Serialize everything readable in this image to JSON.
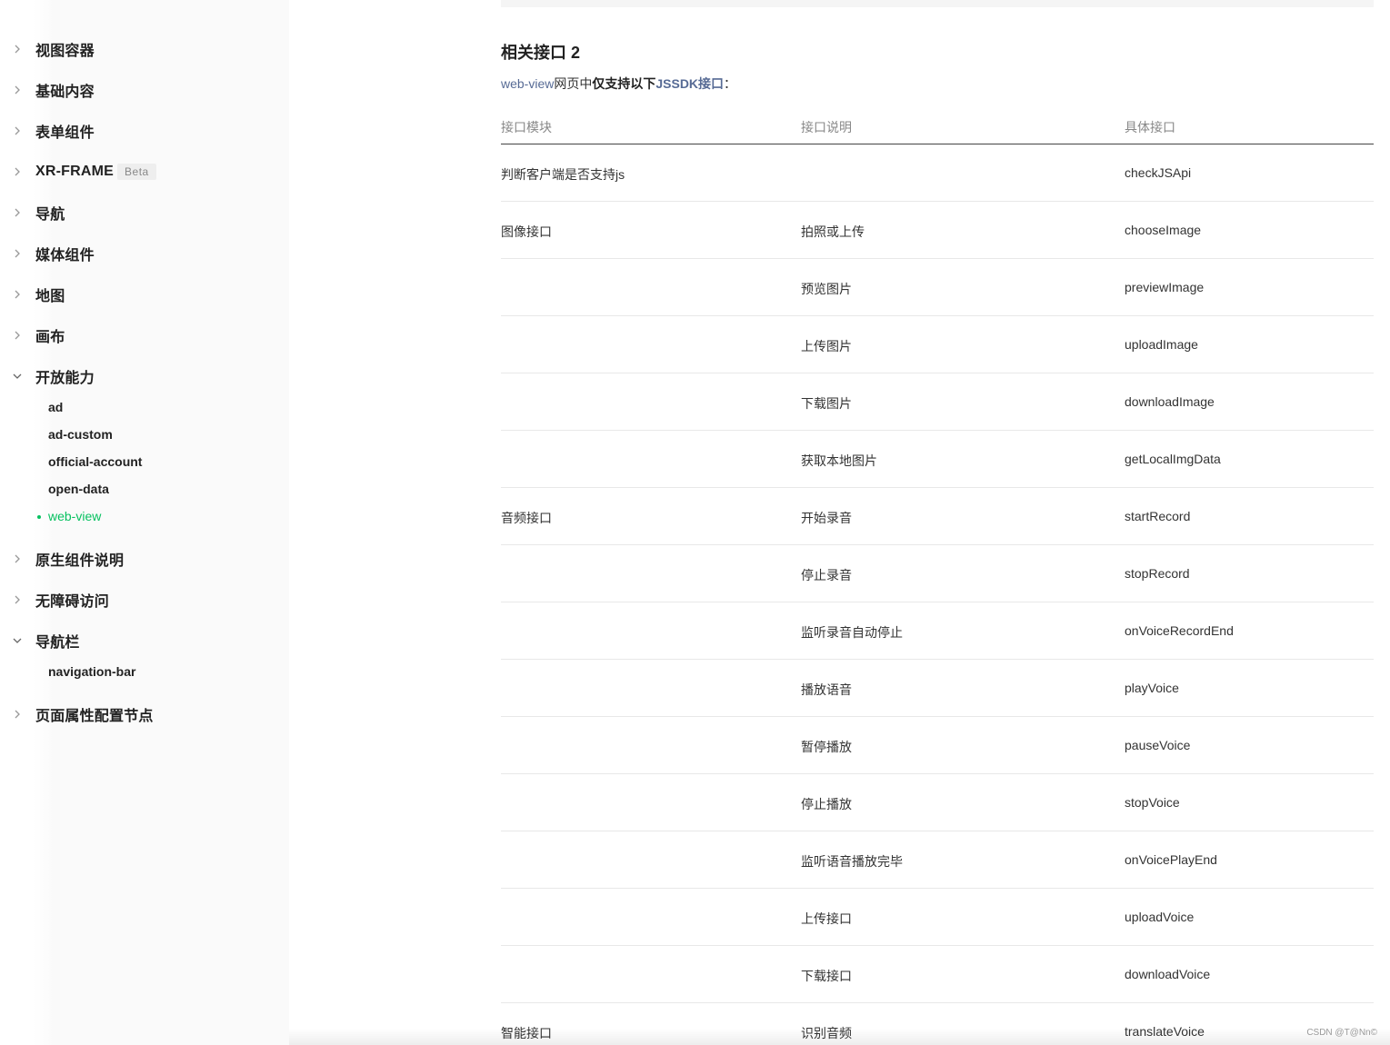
{
  "sidebar": {
    "items": [
      {
        "label": "视图容器",
        "expanded": false
      },
      {
        "label": "基础内容",
        "expanded": false
      },
      {
        "label": "表单组件",
        "expanded": false
      },
      {
        "label": "XR-FRAME",
        "badge": "Beta",
        "expanded": false
      },
      {
        "label": "导航",
        "expanded": false
      },
      {
        "label": "媒体组件",
        "expanded": false
      },
      {
        "label": "地图",
        "expanded": false
      },
      {
        "label": "画布",
        "expanded": false
      },
      {
        "label": "开放能力",
        "expanded": true
      },
      {
        "label": "原生组件说明",
        "expanded": false
      },
      {
        "label": "无障碍访问",
        "expanded": false
      },
      {
        "label": "导航栏",
        "expanded": true
      },
      {
        "label": "页面属性配置节点",
        "expanded": false
      }
    ],
    "open_ability_children": [
      "ad",
      "ad-custom",
      "official-account",
      "open-data",
      "web-view"
    ],
    "navbar_children": [
      "navigation-bar"
    ],
    "active_item": "web-view"
  },
  "main": {
    "heading": "相关接口 2",
    "intro": {
      "link_webview": "web-view",
      "text1": "网页中",
      "bold": "仅支持以下",
      "link_jssdk": "JSSDK接口",
      "text2": "："
    },
    "table": {
      "headers": [
        "接口模块",
        "接口说明",
        "具体接口"
      ],
      "rows": [
        [
          "判断客户端是否支持js",
          "",
          "checkJSApi"
        ],
        [
          "图像接口",
          "拍照或上传",
          "chooseImage"
        ],
        [
          "",
          "预览图片",
          "previewImage"
        ],
        [
          "",
          "上传图片",
          "uploadImage"
        ],
        [
          "",
          "下载图片",
          "downloadImage"
        ],
        [
          "",
          "获取本地图片",
          "getLocalImgData"
        ],
        [
          "音频接口",
          "开始录音",
          "startRecord"
        ],
        [
          "",
          "停止录音",
          "stopRecord"
        ],
        [
          "",
          "监听录音自动停止",
          "onVoiceRecordEnd"
        ],
        [
          "",
          "播放语音",
          "playVoice"
        ],
        [
          "",
          "暂停播放",
          "pauseVoice"
        ],
        [
          "",
          "停止播放",
          "stopVoice"
        ],
        [
          "",
          "监听语音播放完毕",
          "onVoicePlayEnd"
        ],
        [
          "",
          "上传接口",
          "uploadVoice"
        ],
        [
          "",
          "下载接口",
          "downloadVoice"
        ],
        [
          "智能接口",
          "识别音频",
          "translateVoice"
        ]
      ]
    }
  },
  "watermark": "CSDN @T@Nn©",
  "colors": {
    "accent_green": "#07c160",
    "link_blue": "#576b95"
  }
}
